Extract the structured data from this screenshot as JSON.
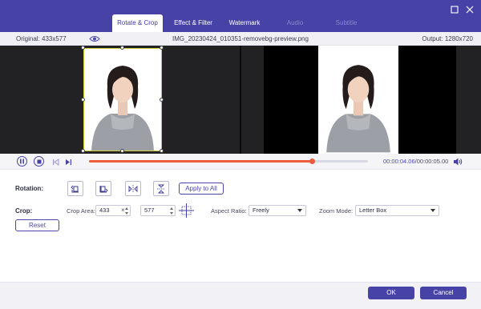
{
  "tabs": [
    {
      "label": "Rotate & Crop",
      "state": "active"
    },
    {
      "label": "Effect & Filter",
      "state": "normal"
    },
    {
      "label": "Watermark",
      "state": "normal"
    },
    {
      "label": "Audio",
      "state": "disabled"
    },
    {
      "label": "Subtitle",
      "state": "disabled"
    }
  ],
  "window_controls": {
    "maximize_icon": "maximize-icon",
    "close_icon": "close-icon"
  },
  "info_bar": {
    "original": "Original: 433x577",
    "filename": "IMG_20230424_010351-removebg-preview.png",
    "output": "Output: 1280x720",
    "eye_icon": "eye-icon"
  },
  "playback": {
    "progress": 0.8,
    "current_time": "00:00:04.06",
    "total_time": "/00:00:05.00",
    "icons": [
      "pause-icon",
      "stop-icon",
      "skip-back-icon",
      "skip-forward-icon",
      "volume-icon"
    ]
  },
  "rotation": {
    "label": "Rotation:",
    "buttons": [
      "rotate-left-icon",
      "rotate-right-icon",
      "flip-horizontal-icon",
      "flip-vertical-icon"
    ],
    "apply_all": "Apply to All"
  },
  "crop": {
    "label": "Crop:",
    "area_label": "Crop Area:",
    "width": "433",
    "times": "×",
    "height": "577",
    "aspect_label": "Aspect Ratio:",
    "aspect_value": "Freely",
    "zoom_label": "Zoom Mode:",
    "zoom_value": "Letter Box",
    "reset": "Reset"
  },
  "footer": {
    "ok": "OK",
    "cancel": "Cancel"
  },
  "colors": {
    "brand": "#4743a6",
    "progress": "#ee5a3c",
    "crop_frame": "#d0cd3a"
  }
}
